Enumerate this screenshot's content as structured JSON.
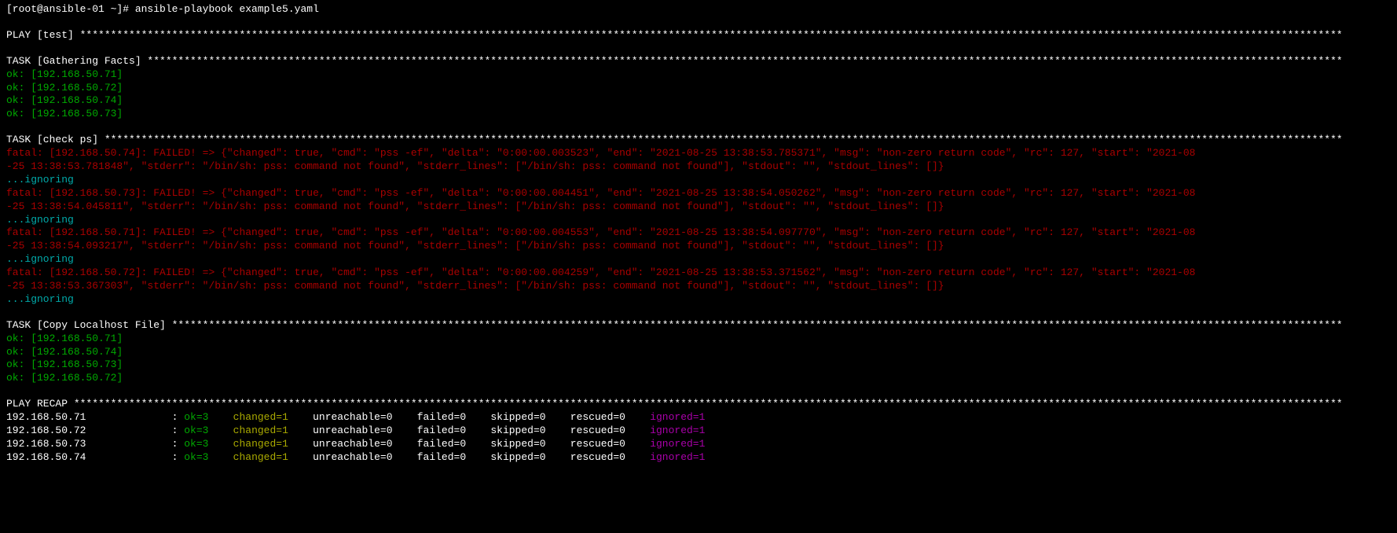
{
  "prompt": {
    "user": "root",
    "host": "ansible-01",
    "cwd": "~",
    "command": "ansible-playbook example5.yaml"
  },
  "play": {
    "name": "test"
  },
  "tasks": {
    "gathering": {
      "name": "Gathering Facts",
      "ok_hosts": [
        "192.168.50.71",
        "192.168.50.72",
        "192.168.50.74",
        "192.168.50.73"
      ]
    },
    "check_ps": {
      "name": "check ps",
      "failures": [
        {
          "host": "192.168.50.74",
          "line1": "fatal: [192.168.50.74]: FAILED! => {\"changed\": true, \"cmd\": \"pss -ef\", \"delta\": \"0:00:00.003523\", \"end\": \"2021-08-25 13:38:53.785371\", \"msg\": \"non-zero return code\", \"rc\": 127, \"start\": \"2021-08",
          "line2": "-25 13:38:53.781848\", \"stderr\": \"/bin/sh: pss: command not found\", \"stderr_lines\": [\"/bin/sh: pss: command not found\"], \"stdout\": \"\", \"stdout_lines\": []}"
        },
        {
          "host": "192.168.50.73",
          "line1": "fatal: [192.168.50.73]: FAILED! => {\"changed\": true, \"cmd\": \"pss -ef\", \"delta\": \"0:00:00.004451\", \"end\": \"2021-08-25 13:38:54.050262\", \"msg\": \"non-zero return code\", \"rc\": 127, \"start\": \"2021-08",
          "line2": "-25 13:38:54.045811\", \"stderr\": \"/bin/sh: pss: command not found\", \"stderr_lines\": [\"/bin/sh: pss: command not found\"], \"stdout\": \"\", \"stdout_lines\": []}"
        },
        {
          "host": "192.168.50.71",
          "line1": "fatal: [192.168.50.71]: FAILED! => {\"changed\": true, \"cmd\": \"pss -ef\", \"delta\": \"0:00:00.004553\", \"end\": \"2021-08-25 13:38:54.097770\", \"msg\": \"non-zero return code\", \"rc\": 127, \"start\": \"2021-08",
          "line2": "-25 13:38:54.093217\", \"stderr\": \"/bin/sh: pss: command not found\", \"stderr_lines\": [\"/bin/sh: pss: command not found\"], \"stdout\": \"\", \"stdout_lines\": []}"
        },
        {
          "host": "192.168.50.72",
          "line1": "fatal: [192.168.50.72]: FAILED! => {\"changed\": true, \"cmd\": \"pss -ef\", \"delta\": \"0:00:00.004259\", \"end\": \"2021-08-25 13:38:53.371562\", \"msg\": \"non-zero return code\", \"rc\": 127, \"start\": \"2021-08",
          "line2": "-25 13:38:53.367303\", \"stderr\": \"/bin/sh: pss: command not found\", \"stderr_lines\": [\"/bin/sh: pss: command not found\"], \"stdout\": \"\", \"stdout_lines\": []}"
        }
      ],
      "ignoring": "...ignoring"
    },
    "copy": {
      "name": "Copy Localhost File",
      "ok_hosts": [
        "192.168.50.71",
        "192.168.50.74",
        "192.168.50.73",
        "192.168.50.72"
      ]
    }
  },
  "recap": {
    "header": "PLAY RECAP",
    "rows": [
      {
        "host": "192.168.50.71",
        "ok": 3,
        "changed": 1,
        "unreachable": 0,
        "failed": 0,
        "skipped": 0,
        "rescued": 0,
        "ignored": 1
      },
      {
        "host": "192.168.50.72",
        "ok": 3,
        "changed": 1,
        "unreachable": 0,
        "failed": 0,
        "skipped": 0,
        "rescued": 0,
        "ignored": 1
      },
      {
        "host": "192.168.50.73",
        "ok": 3,
        "changed": 1,
        "unreachable": 0,
        "failed": 0,
        "skipped": 0,
        "rescued": 0,
        "ignored": 1
      },
      {
        "host": "192.168.50.74",
        "ok": 3,
        "changed": 1,
        "unreachable": 0,
        "failed": 0,
        "skipped": 0,
        "rescued": 0,
        "ignored": 1
      }
    ]
  },
  "labels": {
    "play_prefix": "PLAY",
    "task_prefix": "TASK",
    "ok_prefix": "ok:",
    "colon": ":",
    "ok": "ok",
    "changed": "changed",
    "unreachable": "unreachable",
    "failed": "failed",
    "skipped": "skipped",
    "rescued": "rescued",
    "ignored": "ignored"
  }
}
